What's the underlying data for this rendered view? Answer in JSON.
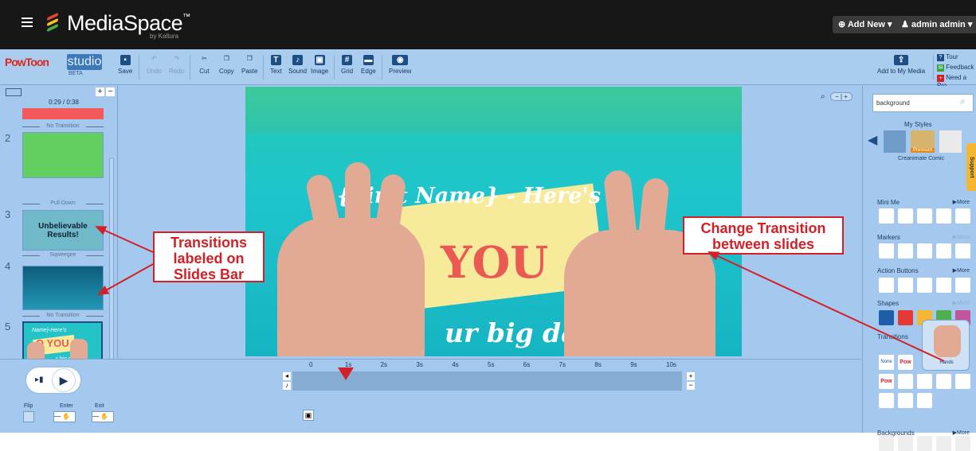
{
  "app": {
    "brand": "MediaSpace",
    "tm": "™",
    "sub": "by Kaltura"
  },
  "header": {
    "add_new": "⊕ Add New ▾",
    "user": "♟ admin admin ▾"
  },
  "toolbar": {
    "logo": "PowToon",
    "studio": "studio",
    "beta": "BETA",
    "save": "Save",
    "undo": "Undo",
    "redo": "Redo",
    "cut": "Cut",
    "copy": "Copy",
    "paste": "Paste",
    "text": "Text",
    "sound": "Sound",
    "image": "Image",
    "grid": "Grid",
    "edge": "Edge",
    "preview": "Preview",
    "add_media": "Add to My Media",
    "tour": "Tour",
    "feedback": "Feedback",
    "need": "Need a Pro"
  },
  "slides": {
    "time": "0:29 / 0:38",
    "items": [
      {
        "num": "",
        "transition": "No Transition"
      },
      {
        "num": "2",
        "transition": "Pull Down"
      },
      {
        "num": "3",
        "transition": "Sqweegee",
        "title": "Unbelievable Results!"
      },
      {
        "num": "4",
        "transition": "No Transition"
      },
      {
        "num": "5",
        "transition": ""
      }
    ],
    "thumb5_a": "Name}-Here's",
    "thumb5_b": "O YOU",
    "thumb5_c": "r big day!"
  },
  "stage": {
    "line1": "{First Name} - Here's",
    "line2": "O YOU",
    "line3": "ur big day!"
  },
  "timeline": {
    "labels": [
      "0",
      "1s",
      "2s",
      "3s",
      "4s",
      "5s",
      "6s",
      "7s",
      "8s",
      "9s",
      "10s"
    ],
    "flip": "Flip",
    "enter": "Enter",
    "exit": "Exit"
  },
  "panel": {
    "search": "background",
    "my_styles": "My Styles",
    "premium": "Premium",
    "creanimate": "Creanimate Comic",
    "mini_me": "Mini Me",
    "markers": "Markers",
    "action_buttons": "Action Buttons",
    "shapes": "Shapes",
    "transitions": "Transitions",
    "none": "None",
    "hands": "Hands",
    "backgrounds": "Backgrounds",
    "more": "▶More",
    "support": "Support"
  },
  "callouts": {
    "left": "Transitions labeled on Slides Bar",
    "right": "Change Transition between slides"
  },
  "colors": {
    "accent": "#d51f26",
    "stage": "#1ec5cc",
    "panel": "#a4c8ee"
  }
}
